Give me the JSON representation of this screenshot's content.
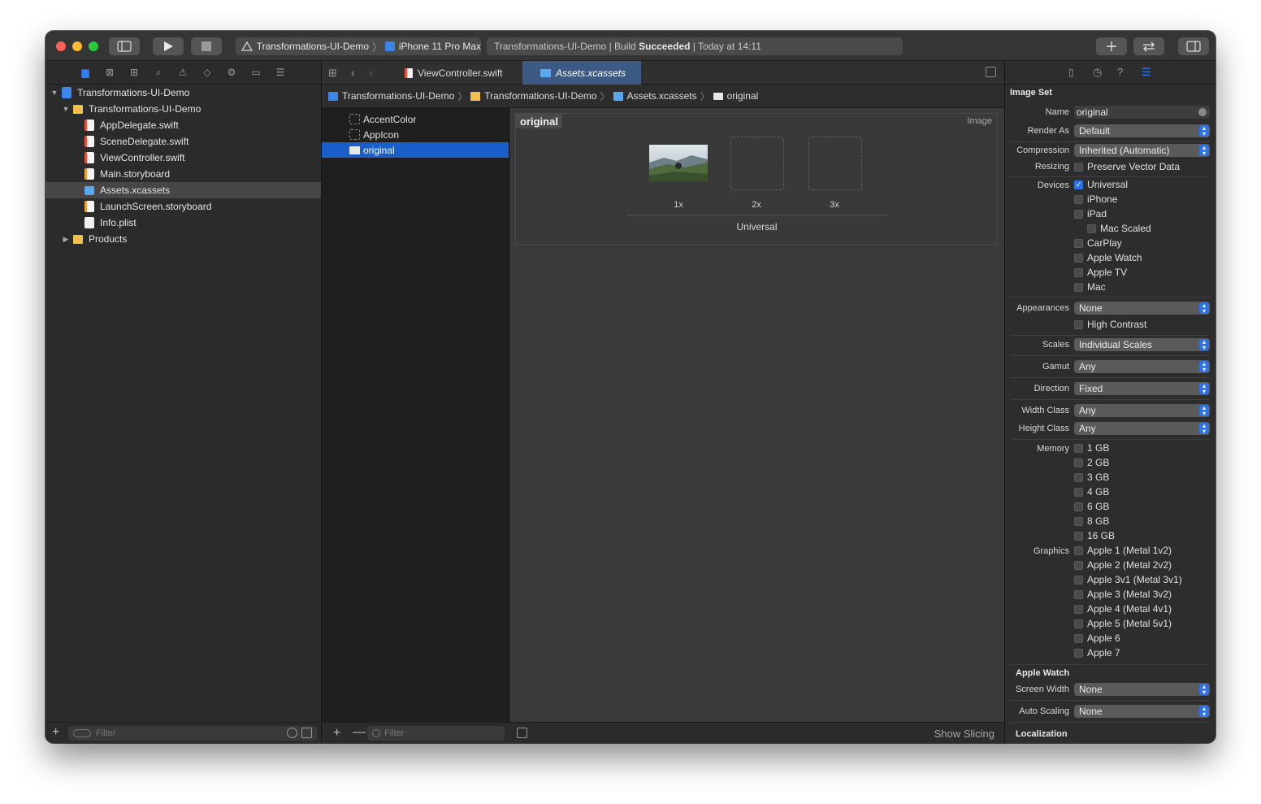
{
  "toolbar": {
    "scheme_target": "Transformations-UI-Demo",
    "scheme_device": "iPhone 11 Pro Max",
    "status_prefix": "Transformations-UI-Demo | Build",
    "status_bold": "Succeeded",
    "status_suffix": "| Today at 14:11"
  },
  "navigator": {
    "tree": [
      {
        "label": "Transformations-UI-Demo",
        "icon": "project-icon"
      },
      {
        "label": "Transformations-UI-Demo",
        "icon": "folder-icon"
      },
      {
        "label": "AppDelegate.swift",
        "icon": "swift-file-icon"
      },
      {
        "label": "SceneDelegate.swift",
        "icon": "swift-file-icon"
      },
      {
        "label": "ViewController.swift",
        "icon": "swift-file-icon"
      },
      {
        "label": "Main.storyboard",
        "icon": "storyboard-icon"
      },
      {
        "label": "Assets.xcassets",
        "icon": "assets-folder-icon"
      },
      {
        "label": "LaunchScreen.storyboard",
        "icon": "storyboard-icon"
      },
      {
        "label": "Info.plist",
        "icon": "plist-icon"
      },
      {
        "label": "Products",
        "icon": "folder-icon"
      }
    ],
    "filter_placeholder": "Filter"
  },
  "editor": {
    "tabs": [
      {
        "label": "ViewController.swift"
      },
      {
        "label": "Assets.xcassets"
      }
    ],
    "jumpbar": [
      "Transformations-UI-Demo",
      "Transformations-UI-Demo",
      "Assets.xcassets",
      "original"
    ],
    "assets": [
      "AccentColor",
      "AppIcon",
      "original"
    ],
    "asset_filter_placeholder": "Filter",
    "image_set": {
      "name": "original",
      "type": "Image",
      "slots": [
        "1x",
        "2x",
        "3x"
      ],
      "group": "Universal"
    },
    "show_slicing": "Show Slicing"
  },
  "inspector": {
    "section_title": "Image Set",
    "name_label": "Name",
    "name_value": "original",
    "render_as_label": "Render As",
    "render_as_value": "Default",
    "compression_label": "Compression",
    "compression_value": "Inherited (Automatic)",
    "resizing_label": "Resizing",
    "resizing_option": "Preserve Vector Data",
    "devices_label": "Devices",
    "devices": [
      {
        "label": "Universal",
        "checked": true
      },
      {
        "label": "iPhone",
        "checked": false
      },
      {
        "label": "iPad",
        "checked": false
      },
      {
        "label": "Mac Scaled",
        "checked": false
      },
      {
        "label": "CarPlay",
        "checked": false
      },
      {
        "label": "Apple Watch",
        "checked": false
      },
      {
        "label": "Apple TV",
        "checked": false
      },
      {
        "label": "Mac",
        "checked": false
      }
    ],
    "appearances_label": "Appearances",
    "appearances_value": "None",
    "high_contrast": "High Contrast",
    "scales_label": "Scales",
    "scales_value": "Individual Scales",
    "gamut_label": "Gamut",
    "gamut_value": "Any",
    "direction_label": "Direction",
    "direction_value": "Fixed",
    "width_class_label": "Width Class",
    "width_class_value": "Any",
    "height_class_label": "Height Class",
    "height_class_value": "Any",
    "memory_label": "Memory",
    "memory": [
      "1 GB",
      "2 GB",
      "3 GB",
      "4 GB",
      "6 GB",
      "8 GB",
      "16 GB"
    ],
    "graphics_label": "Graphics",
    "graphics": [
      "Apple 1 (Metal 1v2)",
      "Apple 2 (Metal 2v2)",
      "Apple 3v1 (Metal 3v1)",
      "Apple 3 (Metal 3v2)",
      "Apple 4 (Metal 4v1)",
      "Apple 5 (Metal 5v1)",
      "Apple 6",
      "Apple 7"
    ],
    "watch_section": "Apple Watch",
    "screen_width_label": "Screen Width",
    "screen_width_value": "None",
    "auto_scaling_label": "Auto Scaling",
    "auto_scaling_value": "None",
    "localization_section": "Localization"
  },
  "colors": {
    "accent": "#2f72e6",
    "selection": "#1a5ec9",
    "active_tab": "#3c5a84"
  }
}
